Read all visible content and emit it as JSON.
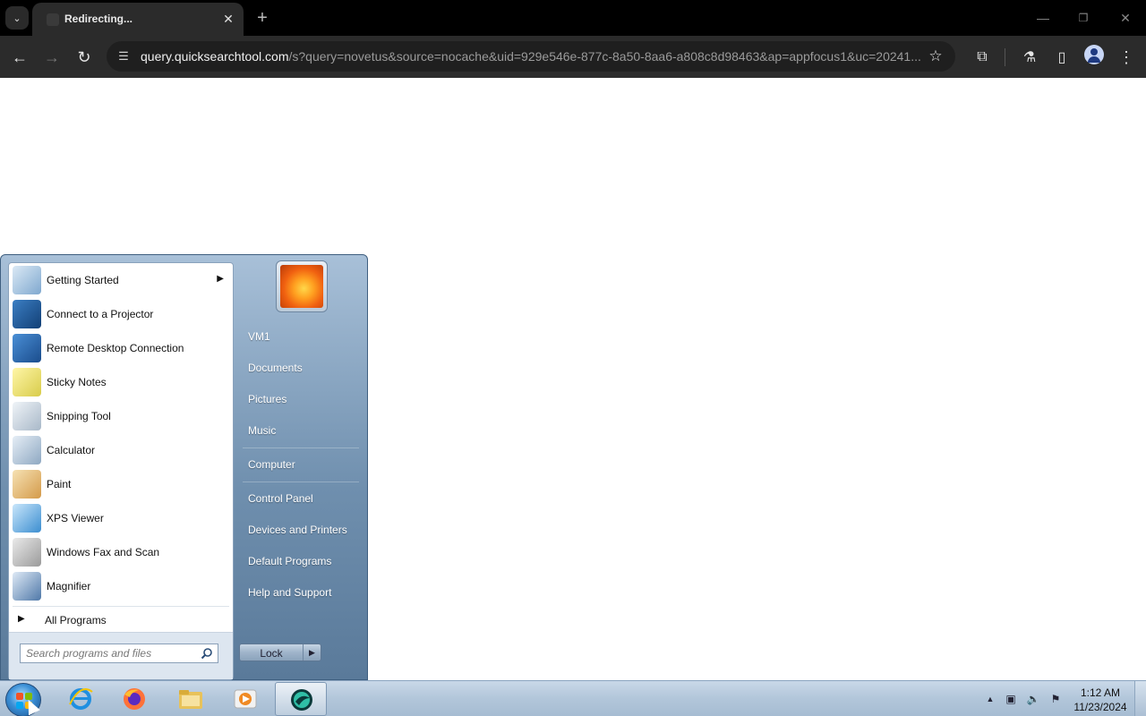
{
  "browser": {
    "tab": {
      "title": "Redirecting...",
      "close_icon": "close-icon"
    },
    "new_tab_icon": "plus-icon",
    "url": {
      "host": "query.quicksearchtool.com",
      "path": "/s?query=novetus&source=nocache&uid=929e546e-877c-8a50-8aa6-a808c8d98463&ap=appfocus1&uc=20241..."
    },
    "icons": [
      "back-icon",
      "forward-icon",
      "reload-icon",
      "site-info-icon",
      "bookmark-star-icon",
      "extensions-icon",
      "labs-icon",
      "side-panel-icon",
      "profile-icon",
      "menu-icon"
    ]
  },
  "start_menu": {
    "programs": [
      {
        "label": "Getting Started",
        "has_submenu": true,
        "icon": "getting-started-icon"
      },
      {
        "label": "Connect to a Projector",
        "icon": "projector-icon"
      },
      {
        "label": "Remote Desktop Connection",
        "icon": "remote-desktop-icon"
      },
      {
        "label": "Sticky Notes",
        "icon": "sticky-notes-icon"
      },
      {
        "label": "Snipping Tool",
        "icon": "scissors-icon"
      },
      {
        "label": "Calculator",
        "icon": "calculator-icon"
      },
      {
        "label": "Paint",
        "icon": "paint-palette-icon"
      },
      {
        "label": "XPS Viewer",
        "icon": "xps-viewer-icon"
      },
      {
        "label": "Windows Fax and Scan",
        "icon": "fax-icon"
      },
      {
        "label": "Magnifier",
        "icon": "magnifier-icon"
      }
    ],
    "all_programs": "All Programs",
    "search_placeholder": "Search programs and files",
    "right_links": {
      "user": "VM1",
      "documents": "Documents",
      "pictures": "Pictures",
      "music": "Music",
      "computer": "Computer",
      "control_panel": "Control Panel",
      "devices": "Devices and Printers",
      "default_programs": "Default Programs",
      "help": "Help and Support"
    },
    "lock_label": "Lock"
  },
  "taskbar": {
    "apps": [
      "internet-explorer-icon",
      "firefox-icon",
      "file-explorer-icon",
      "media-player-icon",
      "browser-app-icon"
    ],
    "tray": [
      "show-hidden-icons-icon",
      "network-icon",
      "volume-muted-icon",
      "action-center-flag-icon"
    ],
    "clock": {
      "time": "1:12 AM",
      "date": "11/23/2024"
    }
  },
  "colors": {
    "taskbar": "#b2c6da",
    "startmenu": "#6f8fae",
    "browser_dark": "#2b2b2b"
  }
}
